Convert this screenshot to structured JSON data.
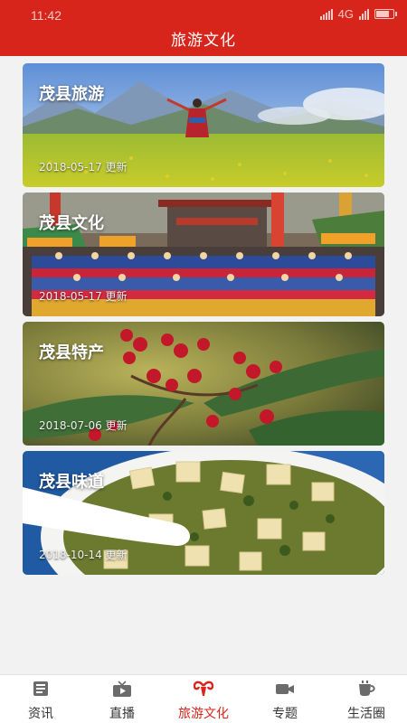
{
  "status": {
    "time": "11:42",
    "network": "4G"
  },
  "header": {
    "title": "旅游文化"
  },
  "cards": [
    {
      "title": "茂县旅游",
      "date": "2018-05-17 更新",
      "image": "mountain-meadow-dancer"
    },
    {
      "title": "茂县文化",
      "date": "2018-05-17 更新",
      "image": "festival-crowd-gate"
    },
    {
      "title": "茂县特产",
      "date": "2018-07-06 更新",
      "image": "sichuan-pepper-branch"
    },
    {
      "title": "茂县味道",
      "date": "2018-10-14 更新",
      "image": "tofu-pickled-greens-bowl"
    }
  ],
  "tabs": [
    {
      "label": "资讯",
      "icon": "news-icon",
      "active": false
    },
    {
      "label": "直播",
      "icon": "tv-icon",
      "active": false
    },
    {
      "label": "旅游文化",
      "icon": "ram-horn-icon",
      "active": true
    },
    {
      "label": "专题",
      "icon": "video-camera-icon",
      "active": false
    },
    {
      "label": "生活圈",
      "icon": "coffee-cup-icon",
      "active": false
    }
  ],
  "colors": {
    "brand": "#d8251b",
    "tab_text": "#333333"
  }
}
